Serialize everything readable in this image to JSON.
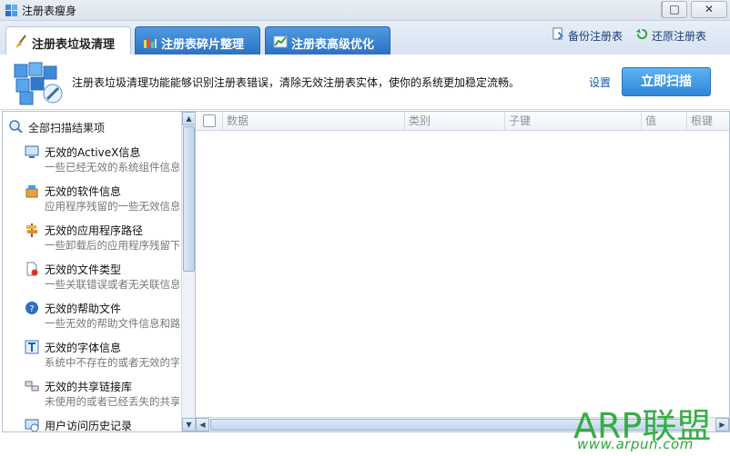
{
  "window": {
    "title": "注册表瘦身"
  },
  "tabs": [
    {
      "label": "注册表垃圾清理",
      "active": true,
      "icon": "broom-icon"
    },
    {
      "label": "注册表碎片整理",
      "active": false,
      "icon": "defrag-icon"
    },
    {
      "label": "注册表高级优化",
      "active": false,
      "icon": "chart-icon"
    }
  ],
  "top_links": {
    "backup": "备份注册表",
    "restore": "还原注册表"
  },
  "header": {
    "description": "注册表垃圾清理功能能够识别注册表错误，清除无效注册表实体，使你的系统更加稳定流畅。",
    "settings": "设置",
    "scan_button": "立即扫描"
  },
  "results": {
    "header": "全部扫描结果项",
    "items": [
      {
        "title": "无效的ActiveX信息",
        "subtitle": "一些已经无效的系统组件信息",
        "icon": "monitor-icon"
      },
      {
        "title": "无效的软件信息",
        "subtitle": "应用程序残留的一些无效信息",
        "icon": "software-box-icon"
      },
      {
        "title": "无效的应用程序路径",
        "subtitle": "一些卸载后的应用程序残留下",
        "icon": "signpost-icon"
      },
      {
        "title": "无效的文件类型",
        "subtitle": "一些关联错误或者无关联信息",
        "icon": "file-error-icon"
      },
      {
        "title": "无效的帮助文件",
        "subtitle": "一些无效的帮助文件信息和路",
        "icon": "help-icon"
      },
      {
        "title": "无效的字体信息",
        "subtitle": "系统中不存在的或者无效的字",
        "icon": "font-icon"
      },
      {
        "title": "无效的共享链接库",
        "subtitle": "未使用的或者已经丢失的共享",
        "icon": "dll-icon"
      },
      {
        "title": "用户访问历史记录",
        "subtitle": "",
        "icon": "history-icon"
      }
    ]
  },
  "table": {
    "columns": [
      "数据",
      "类别",
      "子键",
      "值",
      "根键"
    ]
  },
  "watermark": {
    "main": "ARP联盟",
    "url": "www.arpun.com"
  },
  "colors": {
    "accent": "#2f87d8",
    "tab_blue": "#3a83d2",
    "watermark": "#2aa838"
  }
}
